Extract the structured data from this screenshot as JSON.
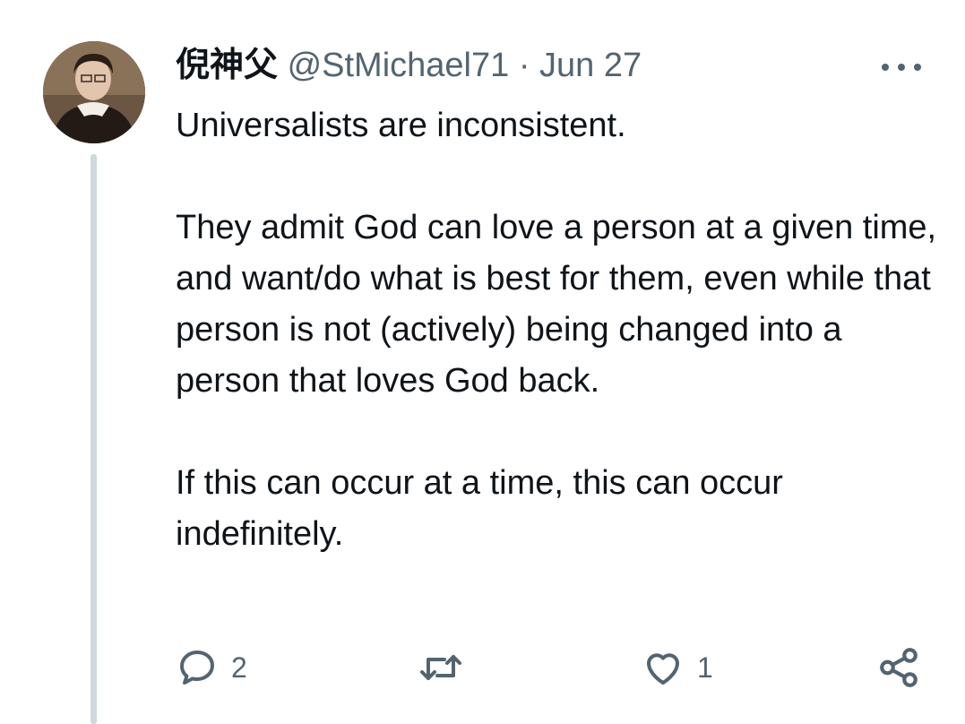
{
  "tweet": {
    "display_name": "倪神父",
    "handle": "@StMichael71",
    "separator": "·",
    "date": "Jun 27",
    "paragraphs": [
      "Universalists are inconsistent.",
      "They admit God can love a person at a given time, and want/do what is best for them, even while that person is not (actively) being changed into a person that loves God back.",
      "If this can occur at a time, this can occur indefinitely."
    ]
  },
  "actions": {
    "reply_icon": "reply-icon",
    "reply_count": "2",
    "retweet_icon": "retweet-icon",
    "like_icon": "heart-icon",
    "like_count": "1",
    "share_icon": "share-icon"
  },
  "colors": {
    "text": "#0f1419",
    "secondary": "#536471",
    "thread_line": "#cfd9de",
    "background": "#ffffff"
  }
}
